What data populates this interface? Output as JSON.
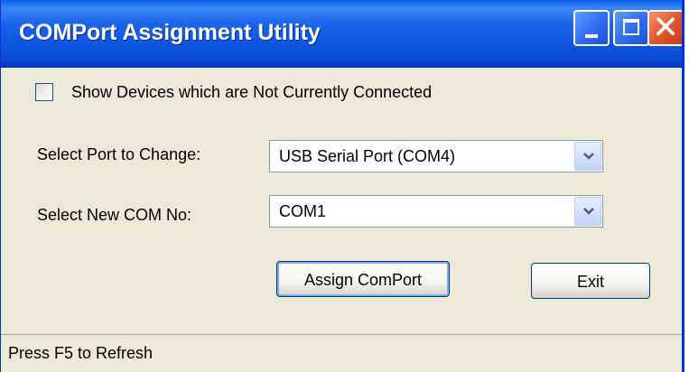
{
  "window": {
    "title": "COMPort Assignment Utility",
    "title_color": "#0a5fe8",
    "controls": [
      "minimize-icon",
      "maximize-icon",
      "close-icon"
    ]
  },
  "checkbox": {
    "label": "Show Devices which are Not Currently Connected",
    "checked": false
  },
  "port_select": {
    "label": "Select Port to Change:",
    "value": "USB Serial Port (COM4)"
  },
  "com_select": {
    "label": "Select New COM No:",
    "value": "COM1"
  },
  "buttons": {
    "assign": "Assign ComPort",
    "exit": "Exit"
  },
  "status": {
    "text": "Press F5 to Refresh"
  }
}
